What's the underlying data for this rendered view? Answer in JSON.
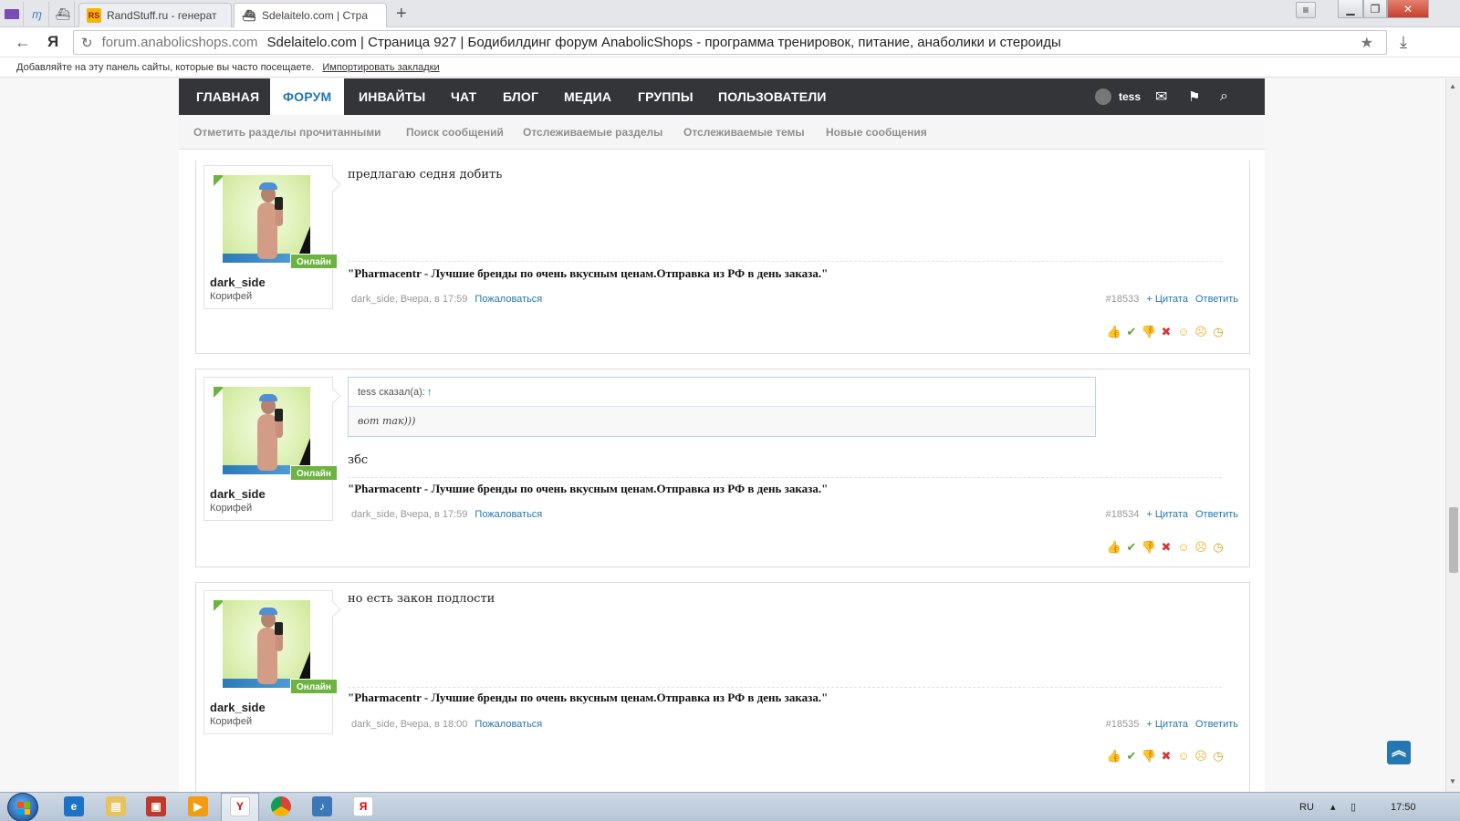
{
  "browser": {
    "tabs": [
      {
        "title": "RandStuff.ru - генерат",
        "favicon": "RS"
      },
      {
        "title": "Sdelaitelo.com | Стра",
        "favicon": "ship-icon"
      }
    ],
    "new_tab": "+",
    "address": {
      "domain": "forum.anabolicshops.com",
      "page_title": "Sdelaitelo.com | Страница 927 | Бодибилдинг форум AnabolicShops - программа тренировок, питание, анаболики и стероиды"
    },
    "yandex_logo": "Я",
    "bookmarks_hint": "Добавляйте на эту панель сайты, которые вы часто посещаете.",
    "import_bookmarks": "Импортировать закладки"
  },
  "forum": {
    "nav": [
      "ГЛАВНАЯ",
      "ФОРУМ",
      "ИНВАЙТЫ",
      "ЧАТ",
      "БЛОГ",
      "МЕДИА",
      "ГРУППЫ",
      "ПОЛЬЗОВАТЕЛИ"
    ],
    "active_nav": "ФОРУМ",
    "username": "tess",
    "subnav": [
      "Отметить разделы прочитанными",
      "Поиск сообщений",
      "Отслеживаемые разделы",
      "Отслеживаемые темы",
      "Новые сообщения"
    ]
  },
  "posts": [
    {
      "author": "dark_side",
      "role": "Корифей",
      "status": "Онлайн",
      "message": "предлагаю седня добить",
      "signature": "\"Pharmacentr - Лучшие бренды по очень вкусным ценам.Отправка из РФ в день заказа.\"",
      "meta": "dark_side, Вчера, в 17:59",
      "report": "Пожаловаться",
      "number": "#18533",
      "quote": "+ Цитата",
      "reply": "Ответить"
    },
    {
      "author": "dark_side",
      "role": "Корифей",
      "status": "Онлайн",
      "quoted": {
        "header": "tess сказал(а):",
        "arrow": "↑",
        "text": "вот так)))"
      },
      "message": "збс",
      "signature": "\"Pharmacentr - Лучшие бренды по очень вкусным ценам.Отправка из РФ в день заказа.\"",
      "meta": "dark_side, Вчера, в 17:59",
      "report": "Пожаловаться",
      "number": "#18534",
      "quote": "+ Цитата",
      "reply": "Ответить"
    },
    {
      "author": "dark_side",
      "role": "Корифей",
      "status": "Онлайн",
      "message": "но есть закон подлости",
      "signature": "\"Pharmacentr - Лучшие бренды по очень вкусным ценам.Отправка из РФ в день заказа.\"",
      "meta": "dark_side, Вчера, в 18:00",
      "report": "Пожаловаться",
      "number": "#18535",
      "quote": "+ Цитата",
      "reply": "Ответить"
    }
  ],
  "reactions": [
    "thumbs-up-icon",
    "check-icon",
    "thumbs-down-icon",
    "cross-icon",
    "smile-icon",
    "sad-icon",
    "clock-icon"
  ],
  "taskbar": {
    "language": "RU",
    "time": "17:50"
  },
  "colors": {
    "accent": "#2577b1",
    "online": "#6cb33f",
    "nav_bg": "#333538"
  }
}
